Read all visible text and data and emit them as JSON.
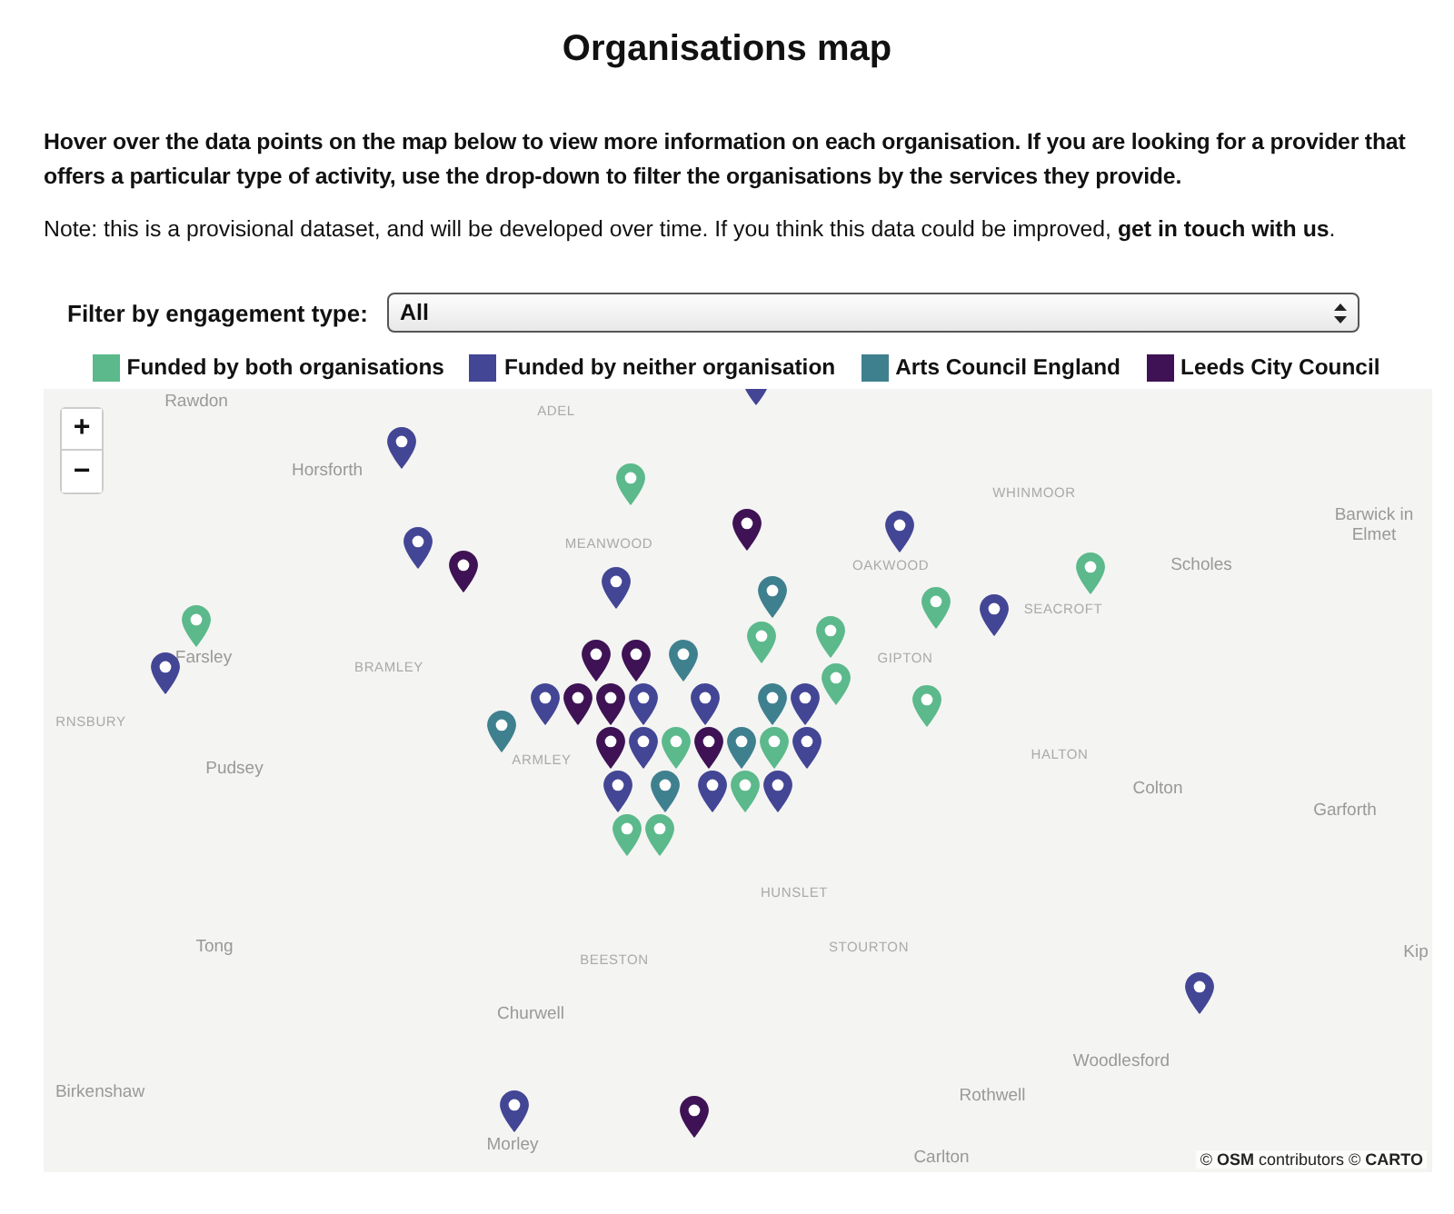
{
  "title": "Organisations map",
  "intro": "Hover over the data points on the map below to view more information on each organisation. If you are looking for a provider that offers a particular type of activity, use the drop-down to filter the organisations by the services they provide.",
  "note": "Note: this is a provisional dataset, and will be developed over time. If you think this data could be improved, ",
  "note_link": "get in touch with us",
  "note_end": ".",
  "filter": {
    "label": "Filter by engagement type:",
    "value": "All"
  },
  "legend": [
    {
      "label": "Funded by both organisations",
      "color": "#5bb98b"
    },
    {
      "label": "Funded by neither organisation",
      "color": "#434595"
    },
    {
      "label": "Arts Council England",
      "color": "#3f808f"
    },
    {
      "label": "Leeds City Council",
      "color": "#3e1254"
    }
  ],
  "map": {
    "zoom_in": "+",
    "zoom_out": "−",
    "places": [
      {
        "name": "Rawdon",
        "kind": "town"
      },
      {
        "name": "ADEL",
        "kind": "district"
      },
      {
        "name": "Horsforth",
        "kind": "town"
      },
      {
        "name": "WHINMOOR",
        "kind": "district"
      },
      {
        "name": "Barwick in Elmet",
        "kind": "town"
      },
      {
        "name": "MEANWOOD",
        "kind": "district"
      },
      {
        "name": "OAKWOOD",
        "kind": "district"
      },
      {
        "name": "Scholes",
        "kind": "town"
      },
      {
        "name": "SEACROFT",
        "kind": "district"
      },
      {
        "name": "Farsley",
        "kind": "town"
      },
      {
        "name": "BRAMLEY",
        "kind": "district"
      },
      {
        "name": "GIPTON",
        "kind": "district"
      },
      {
        "name": "RNSBURY",
        "kind": "district"
      },
      {
        "name": "Pudsey",
        "kind": "town"
      },
      {
        "name": "ARMLEY",
        "kind": "district"
      },
      {
        "name": "HALTON",
        "kind": "district"
      },
      {
        "name": "Colton",
        "kind": "town"
      },
      {
        "name": "Garforth",
        "kind": "town"
      },
      {
        "name": "HUNSLET",
        "kind": "district"
      },
      {
        "name": "Tong",
        "kind": "town"
      },
      {
        "name": "BEESTON",
        "kind": "district"
      },
      {
        "name": "STOURTON",
        "kind": "district"
      },
      {
        "name": "Kip",
        "kind": "town"
      },
      {
        "name": "Churwell",
        "kind": "town"
      },
      {
        "name": "Woodlesford",
        "kind": "town"
      },
      {
        "name": "Birkenshaw",
        "kind": "town"
      },
      {
        "name": "Rothwell",
        "kind": "town"
      },
      {
        "name": "Morley",
        "kind": "town"
      },
      {
        "name": "Carlton",
        "kind": "town"
      }
    ],
    "pins": [
      {
        "color": "#434595"
      },
      {
        "color": "#434595"
      },
      {
        "color": "#5bb98b"
      },
      {
        "color": "#3e1254"
      },
      {
        "color": "#434595"
      },
      {
        "color": "#434595"
      },
      {
        "color": "#3e1254"
      },
      {
        "color": "#434595"
      },
      {
        "color": "#3f808f"
      },
      {
        "color": "#5bb98b"
      },
      {
        "color": "#434595"
      },
      {
        "color": "#5bb98b"
      },
      {
        "color": "#5bb98b"
      },
      {
        "color": "#5bb98b"
      },
      {
        "color": "#5bb98b"
      },
      {
        "color": "#434595"
      },
      {
        "color": "#3e1254"
      },
      {
        "color": "#3e1254"
      },
      {
        "color": "#3f808f"
      },
      {
        "color": "#5bb98b"
      },
      {
        "color": "#5bb98b"
      },
      {
        "color": "#434595"
      },
      {
        "color": "#3e1254"
      },
      {
        "color": "#3e1254"
      },
      {
        "color": "#434595"
      },
      {
        "color": "#3f808f"
      },
      {
        "color": "#434595"
      },
      {
        "color": "#3e1254"
      },
      {
        "color": "#434595"
      },
      {
        "color": "#5bb98b"
      },
      {
        "color": "#3f808f"
      },
      {
        "color": "#3f808f"
      },
      {
        "color": "#434595"
      },
      {
        "color": "#434595"
      },
      {
        "color": "#3f808f"
      },
      {
        "color": "#5bb98b"
      },
      {
        "color": "#5bb98b"
      },
      {
        "color": "#434595"
      },
      {
        "color": "#5bb98b"
      },
      {
        "color": "#434595"
      },
      {
        "color": "#3e1254"
      },
      {
        "color": "#5bb98b"
      },
      {
        "color": "#434595"
      },
      {
        "color": "#434595"
      },
      {
        "color": "#3e1254"
      },
      {
        "color": "#434595"
      }
    ],
    "attribution_osm": "OSM",
    "attribution_mid": "contributors",
    "attribution_carto": "CARTO",
    "copyright": "©"
  }
}
